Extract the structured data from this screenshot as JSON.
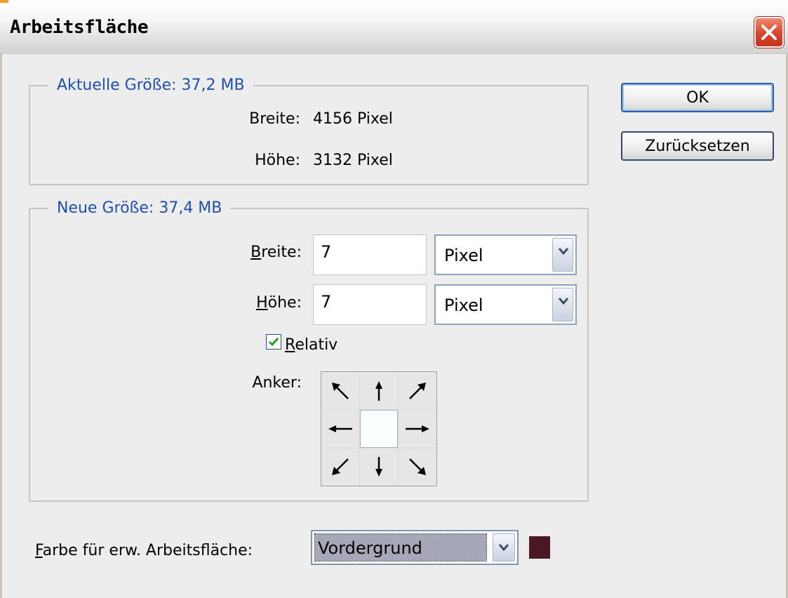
{
  "dialog": {
    "title": "Arbeitsfläche",
    "close_icon": "close-icon"
  },
  "current_size": {
    "legend": "Aktuelle Größe: 37,2 MB",
    "width_label": "Breite:",
    "width_value": "4156 Pixel",
    "height_label": "Höhe:",
    "height_value": "3132 Pixel"
  },
  "new_size": {
    "legend": "Neue Größe: 37,4 MB",
    "width_label_first": "B",
    "width_label_rest": "reite:",
    "width_value": "7",
    "width_unit": "Pixel",
    "height_label_first": "H",
    "height_label_rest": "öhe:",
    "height_value": "7",
    "height_unit": "Pixel",
    "relative_first": "R",
    "relative_rest": "elativ",
    "relative_checked": true,
    "anchor_label": "Anker:",
    "anchor_selected": "center"
  },
  "buttons": {
    "ok": "OK",
    "reset": "Zurücksetzen"
  },
  "extension_color": {
    "label_first": "F",
    "label_rest": "arbe für erw. Arbeitsfläche:",
    "value": "Vordergrund",
    "swatch_color": "#4b1924"
  }
}
